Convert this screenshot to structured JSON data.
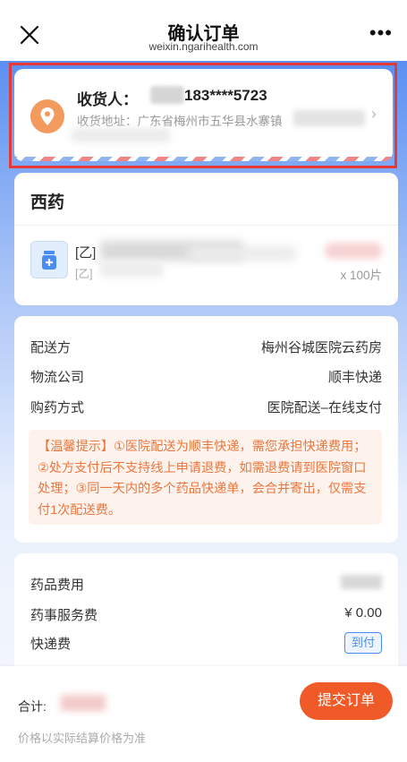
{
  "header": {
    "title": "确认订单",
    "subtitle": "weixin.ngarihealth.com",
    "more": "•••"
  },
  "address": {
    "receiver_label": "收货人：",
    "phone": "183****5723",
    "address_text": "收货地址：广东省梅州市五华县水寨镇",
    "chevron": "›"
  },
  "medicine": {
    "section_title": "西药",
    "drug_name": "[乙]",
    "drug_sub": "[乙]",
    "quantity": "x 100片"
  },
  "delivery": {
    "rows": [
      {
        "label": "配送方",
        "value": "梅州谷城医院云药房"
      },
      {
        "label": "物流公司",
        "value": "顺丰快递"
      },
      {
        "label": "购药方式",
        "value": "医院配送–在线支付"
      }
    ],
    "notice": "【温馨提示】①医院配送为顺丰快递，需您承担快递费用；②处方支付后不支持线上申请退费，如需退费请到医院窗口处理；③同一天内的多个药品快递单，会合并寄出，仅需支付1次配送费。"
  },
  "fees": {
    "rows": [
      {
        "label": "药品费用",
        "value": ""
      },
      {
        "label": "药事服务费",
        "value": "¥ 0.00"
      },
      {
        "label": "快递费",
        "value": "到付"
      }
    ]
  },
  "footer": {
    "total_label": "合计:",
    "submit_label": "提交订单",
    "price_note": "价格以实际结算价格为准"
  },
  "colors": {
    "accent": "#ef5a28",
    "highlight_border": "#e53935",
    "link_blue": "#4a8cf0",
    "notice_text": "#e9773f"
  }
}
